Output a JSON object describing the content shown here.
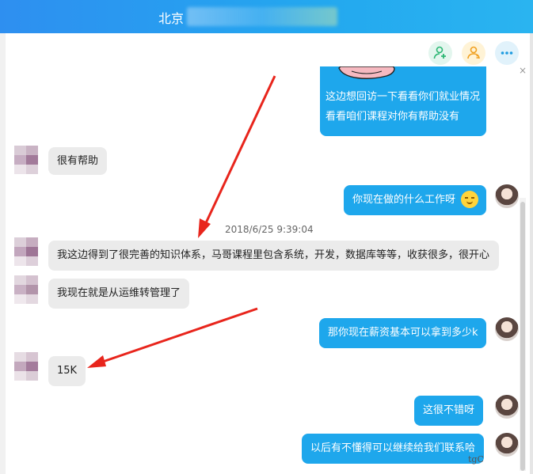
{
  "window": {
    "title": "北京"
  },
  "toolbar": {
    "add_friend_icon": "add-friend-icon",
    "group_icon": "group-icon",
    "more_icon": "more-icon",
    "close_glyph": "×"
  },
  "messages": [
    {
      "side": "right",
      "lines": [
        "这边想回访一下看看你们就业情况",
        "看看咱们课程对你有帮助没有"
      ]
    },
    {
      "side": "left",
      "text": "很有帮助"
    },
    {
      "side": "right",
      "text": "你现在做的什么工作呀"
    },
    {
      "side": "left",
      "text": "我这边得到了很完善的知识体系，马哥课程里包含系统，开发，数据库等等，收获很多，很开心"
    },
    {
      "side": "left",
      "text": "我现在就是从运维转管理了"
    },
    {
      "side": "right",
      "text": "那你现在薪资基本可以拿到多少k"
    },
    {
      "side": "left",
      "text": "15K"
    },
    {
      "side": "right",
      "text": "这很不错呀"
    },
    {
      "side": "right",
      "text": "以后有不懂得可以继续给我们联系哈"
    }
  ],
  "timestamp": "2018/6/25 9:39:04",
  "colors": {
    "title_bar": "#23a8ef",
    "bubble_self": "#1ea7ec",
    "bubble_other": "#ebebeb",
    "annotation_arrow": "#e8251c"
  },
  "watermark": "tgC"
}
